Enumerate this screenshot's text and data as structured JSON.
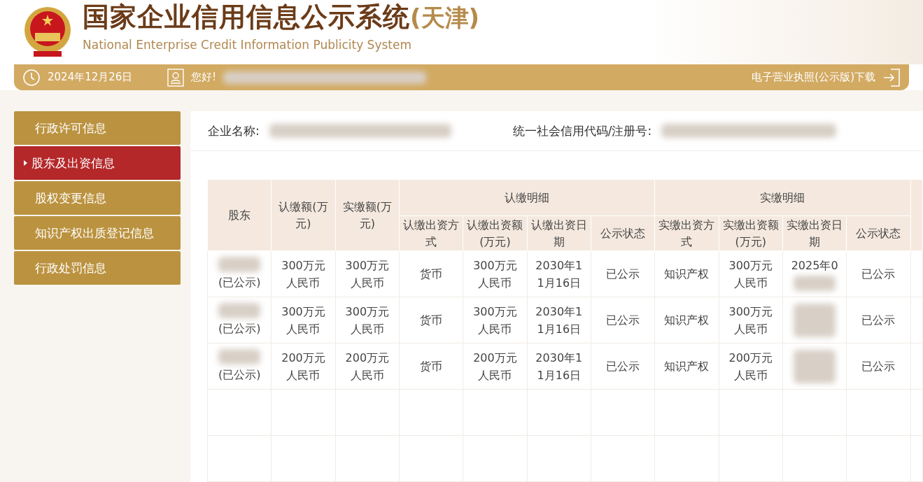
{
  "header": {
    "title": "国家企业信用信息公示系统",
    "region": "(天津)",
    "subtitle": "National Enterprise Credit Information Publicity System"
  },
  "bar": {
    "date": "2024年12月26日",
    "greeting": "您好!",
    "download": "电子营业执照(公示版)下载"
  },
  "sidebar": {
    "items": [
      {
        "label": "行政许可信息",
        "selected": false
      },
      {
        "label": "股东及出资信息",
        "selected": true
      },
      {
        "label": "股权变更信息",
        "selected": false
      },
      {
        "label": "知识产权出质登记信息",
        "selected": false
      },
      {
        "label": "行政处罚信息",
        "selected": false
      }
    ]
  },
  "company": {
    "name_label": "企业名称:",
    "code_label": "统一社会信用代码/注册号:"
  },
  "table": {
    "fixed_columns": [
      "股东",
      "认缴额(万元)",
      "实缴额(万元)"
    ],
    "groups": [
      {
        "title": "认缴明细",
        "columns": [
          "认缴出资方式",
          "认缴出资额(万元)",
          "认缴出资日期",
          "公示状态"
        ]
      },
      {
        "title": "实缴明细",
        "columns": [
          "实缴出资方式",
          "实缴出资额(万元)",
          "实缴出资日期",
          "公示状态"
        ]
      }
    ],
    "rows": [
      {
        "shareholder": "(已公示)",
        "subscribed": "300万元人民币",
        "paid": "300万元人民币",
        "cells": [
          "货币",
          "300万元人民币",
          "2030年11月16日",
          "已公示",
          "知识产权",
          "300万元人民币",
          "2025年0",
          "已公示"
        ]
      },
      {
        "shareholder": "(已公示)",
        "subscribed": "300万元人民币",
        "paid": "300万元人民币",
        "cells": [
          "货币",
          "300万元人民币",
          "2030年11月16日",
          "已公示",
          "知识产权",
          "300万元人民币",
          "",
          "已公示"
        ]
      },
      {
        "shareholder": "(已公示)",
        "subscribed": "200万元人民币",
        "paid": "200万元人民币",
        "cells": [
          "货币",
          "200万元人民币",
          "2030年11月16日",
          "已公示",
          "知识产权",
          "200万元人民币",
          "",
          "已公示"
        ]
      }
    ]
  }
}
